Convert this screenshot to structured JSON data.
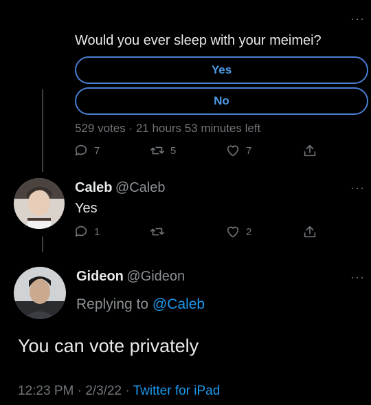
{
  "poll_tweet": {
    "question": "Would you ever sleep with your meimei?",
    "options": [
      "Yes",
      "No"
    ],
    "meta": "529 votes · 21 hours 53 minutes left",
    "actions": {
      "replies": "7",
      "retweets": "5",
      "likes": "7"
    }
  },
  "reply_tweet": {
    "name": "Caleb",
    "handle": "@Caleb",
    "text": "Yes",
    "actions": {
      "replies": "1",
      "retweets": "",
      "likes": "2"
    }
  },
  "main_tweet": {
    "name": "Gideon",
    "handle": "@Gideon",
    "replying_prefix": "Replying to ",
    "replying_to": "@Caleb",
    "text": "You can vote privately",
    "time": "12:23 PM",
    "date": "2/3/22",
    "source": "Twitter for iPad",
    "separator": "·"
  },
  "icons": {
    "more": "more-icon",
    "reply": "reply-icon",
    "retweet": "retweet-icon",
    "like": "heart-icon",
    "share": "share-icon"
  },
  "colors": {
    "accent": "#1d9bf0",
    "poll_border": "#4a7fd4",
    "muted": "#71767b",
    "background": "#000000"
  }
}
